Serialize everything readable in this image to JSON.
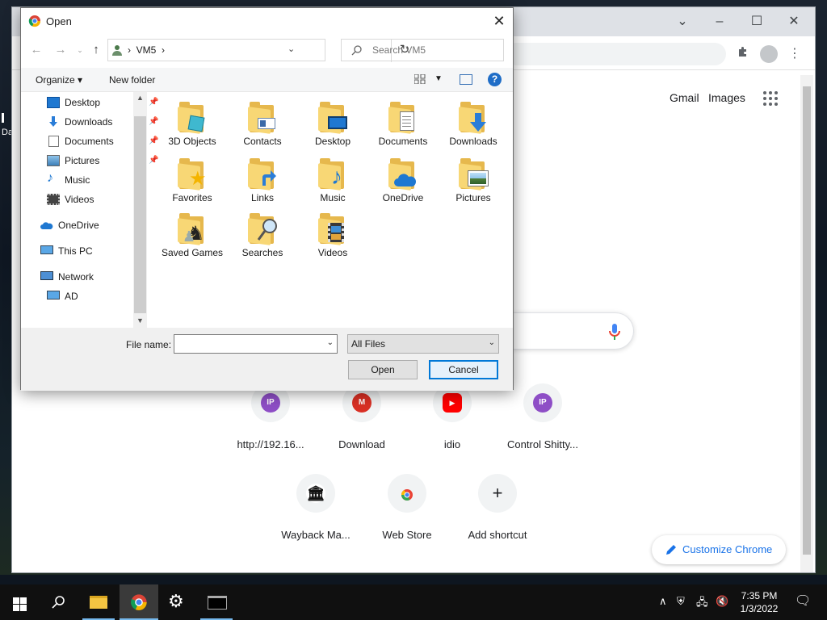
{
  "desktop": {
    "label": "Da"
  },
  "chrome": {
    "links": {
      "gmail": "Gmail",
      "images": "Images"
    },
    "shortcuts": [
      {
        "label": "http://192.16...",
        "glyph": "IP",
        "color": "#8e4ec6"
      },
      {
        "label": "Download",
        "glyph": "M",
        "color": "#d93025"
      },
      {
        "label": "idio",
        "glyph": "▶",
        "color": "#ff0000"
      },
      {
        "label": "Control Shitty...",
        "glyph": "IP",
        "color": "#8e4ec6"
      },
      {
        "label": "Wayback Ma...",
        "glyph": "🏛",
        "color": "#ffffff"
      },
      {
        "label": "Web Store",
        "glyph": "",
        "color": "#ffffff"
      },
      {
        "label": "Add shortcut",
        "glyph": "+",
        "color": "#f1f3f4"
      }
    ],
    "customize_label": "Customize Chrome"
  },
  "dialog": {
    "title": "Open",
    "address": {
      "path": "VM5"
    },
    "search": {
      "placeholder": "Search VM5"
    },
    "toolbar": {
      "organize": "Organize ▾",
      "new_folder": "New folder",
      "help": "?"
    },
    "nav": [
      {
        "label": "Desktop",
        "pinned": true
      },
      {
        "label": "Downloads",
        "pinned": true
      },
      {
        "label": "Documents",
        "pinned": true
      },
      {
        "label": "Pictures",
        "pinned": true
      },
      {
        "label": "Music",
        "pinned": false
      },
      {
        "label": "Videos",
        "pinned": false
      },
      {
        "label": "OneDrive",
        "pinned": false
      },
      {
        "label": "This PC",
        "pinned": false
      },
      {
        "label": "Network",
        "pinned": false
      },
      {
        "label": "AD",
        "pinned": false
      }
    ],
    "files": [
      {
        "label": "3D Objects"
      },
      {
        "label": "Contacts"
      },
      {
        "label": "Desktop"
      },
      {
        "label": "Documents"
      },
      {
        "label": "Downloads"
      },
      {
        "label": "Favorites"
      },
      {
        "label": "Links"
      },
      {
        "label": "Music"
      },
      {
        "label": "OneDrive"
      },
      {
        "label": "Pictures"
      },
      {
        "label": "Saved Games"
      },
      {
        "label": "Searches"
      },
      {
        "label": "Videos"
      }
    ],
    "footer": {
      "file_name_label": "File name:",
      "file_name_value": "",
      "filter": "All Files",
      "open": "Open",
      "cancel": "Cancel"
    }
  },
  "taskbar": {
    "time": "7:35 PM",
    "date": "1/3/2022"
  },
  "colors": {
    "accent": "#0078d7",
    "folder": "#f8d775",
    "chrome_link": "#1a73e8"
  }
}
